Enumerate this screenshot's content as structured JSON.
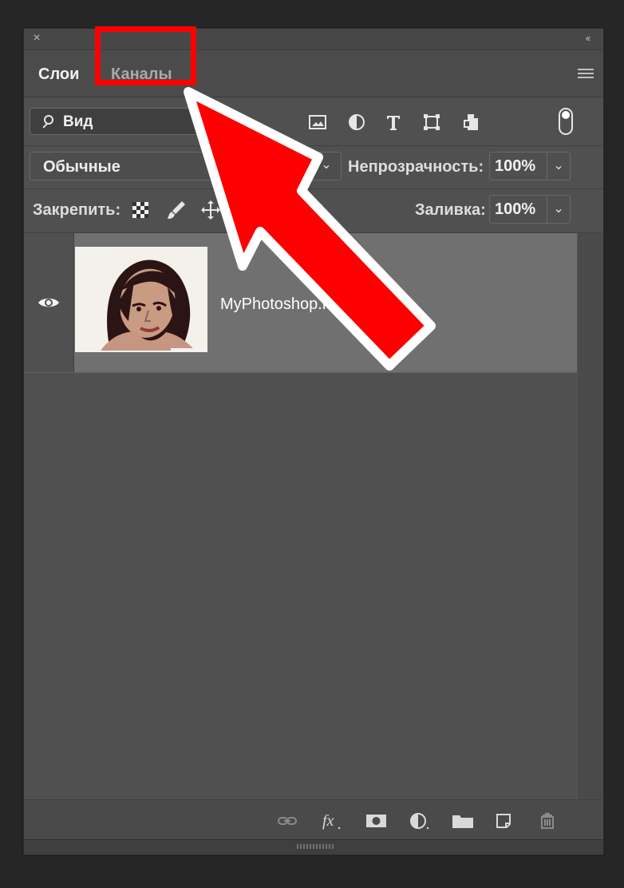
{
  "panel": {
    "tabs": {
      "layers": "Слои",
      "channels": "Каналы"
    },
    "filter": {
      "kind": "Вид"
    },
    "blend": {
      "mode": "Обычные",
      "opacity_label": "Непрозрачность:",
      "opacity_value": "100%"
    },
    "lock": {
      "label": "Закрепить:",
      "fill_label": "Заливка:",
      "fill_value": "100%"
    },
    "layer": {
      "name": "MyPhotoshop.r"
    },
    "bottom_icons": [
      "link-icon",
      "fx-icon",
      "mask-icon",
      "adjustment-icon",
      "folder-icon",
      "new-layer-icon",
      "trash-icon"
    ],
    "filter_icons": [
      "image-filter-icon",
      "adjustment-filter-icon",
      "type-filter-icon",
      "shape-filter-icon",
      "smart-object-filter-icon",
      "filter-toggle-icon"
    ]
  },
  "colors": {
    "panel_bg": "#505050",
    "selected_layer": "#707070",
    "annotation_red": "#ff0000",
    "annotation_white": "#ffffff"
  },
  "icons": {
    "close": "close-icon",
    "collapse": "double-chevron-left-icon",
    "menu": "hamburger-menu-icon",
    "search": "search-icon",
    "eye": "eye-icon"
  },
  "pixel_glyphs": {
    "close": "×",
    "collapse": "‹‹",
    "caret": "⌄"
  }
}
